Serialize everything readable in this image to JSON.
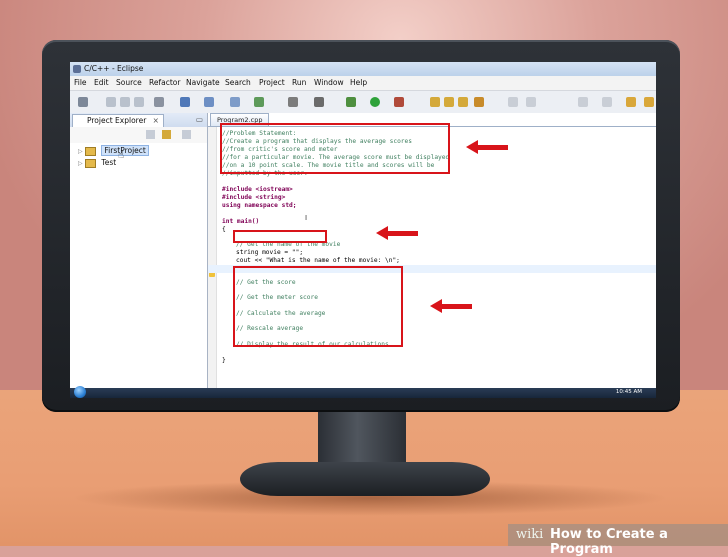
{
  "window": {
    "title": "C/C++ - Eclipse"
  },
  "menu": [
    "File",
    "Edit",
    "Source",
    "Refactor",
    "Navigate",
    "Search",
    "Project",
    "Run",
    "Window",
    "Help"
  ],
  "explorer": {
    "tab_label": "Project Explorer",
    "projects": [
      "FirstProject",
      "Test"
    ]
  },
  "editor": {
    "tab_label": "Program2.cpp",
    "lines": [
      {
        "text": "//Problem Statement:",
        "kind": "comment"
      },
      {
        "text": "//Create a program that displays the average scores",
        "kind": "comment"
      },
      {
        "text": "//from critic's score and meter",
        "kind": "comment"
      },
      {
        "text": "//for a particular movie. The average score must be displayed",
        "kind": "comment"
      },
      {
        "text": "//on a 10 point scale. The movie title and scores will be",
        "kind": "comment"
      },
      {
        "text": "//inputted by the user.",
        "kind": "comment"
      },
      {
        "text": "#include <iostream>",
        "kind": "pp"
      },
      {
        "text": "#include <string>",
        "kind": "pp"
      },
      {
        "text": "using namespace std;",
        "kind": "kw"
      },
      {
        "text": "int main()",
        "kind": "kw"
      },
      {
        "text": "{",
        "kind": "plain"
      },
      {
        "text": "// Get the name of the movie",
        "kind": "comment"
      },
      {
        "text": "string movie = \"\";",
        "kind": "plain"
      },
      {
        "text": "cout << \"What is the name of the movie: \\n\";",
        "kind": "plain"
      },
      {
        "text": "// Get the score",
        "kind": "comment"
      },
      {
        "text": "// Get the meter score",
        "kind": "comment"
      },
      {
        "text": "// Calculate the average",
        "kind": "comment"
      },
      {
        "text": "// Rescale average",
        "kind": "comment"
      },
      {
        "text": "// Display the result of our calculations",
        "kind": "comment"
      },
      {
        "text": "}",
        "kind": "plain"
      }
    ]
  },
  "taskbar": {
    "clock": "10:45 AM"
  },
  "banner": {
    "brand": "wiki",
    "title": "How to Create a Program"
  },
  "colors": {
    "annotation": "#d8141a",
    "comment": "#3f7f5f",
    "keyword": "#7f0055"
  }
}
